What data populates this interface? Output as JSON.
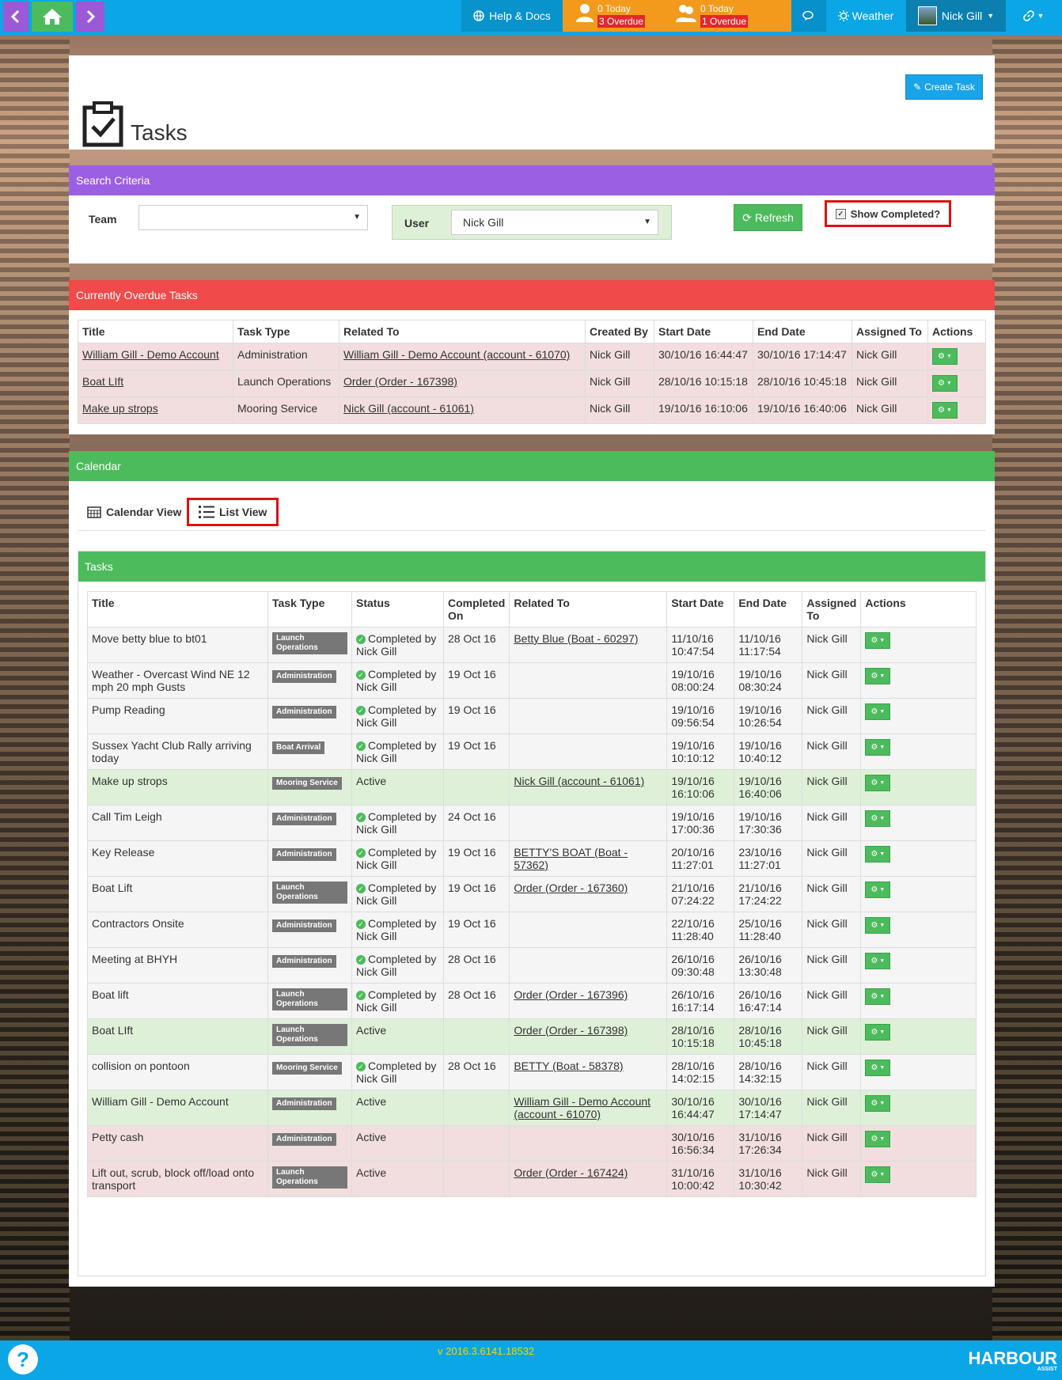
{
  "topbar": {
    "help": "Help & Docs",
    "alert1": {
      "today": "0 Today",
      "overdue": "3 Overdue"
    },
    "alert2": {
      "today": "0 Today",
      "overdue": "1 Overdue"
    },
    "weather": "Weather",
    "user": "Nick Gill"
  },
  "header": {
    "title": "Tasks",
    "create": "Create Task"
  },
  "search": {
    "heading": "Search Criteria",
    "team_label": "Team",
    "team_value": "",
    "user_label": "User",
    "user_value": "Nick Gill",
    "refresh": "Refresh",
    "show_completed": "Show Completed?"
  },
  "overdue": {
    "heading": "Currently Overdue Tasks",
    "columns": [
      "Title",
      "Task Type",
      "Related To",
      "Created By",
      "Start Date",
      "End Date",
      "Assigned To",
      "Actions"
    ],
    "rows": [
      [
        "William Gill - Demo Account",
        "Administration",
        "William Gill - Demo Account (account - 61070)",
        "Nick Gill",
        "30/10/16 16:44:47",
        "30/10/16 17:14:47",
        "Nick Gill"
      ],
      [
        "Boat LIft",
        "Launch Operations",
        "Order (Order - 167398)",
        "Nick Gill",
        "28/10/16 10:15:18",
        "28/10/16 10:45:18",
        "Nick Gill"
      ],
      [
        "Make up strops",
        "Mooring Service",
        "Nick Gill (account - 61061)",
        "Nick Gill",
        "19/10/16 16:10:06",
        "19/10/16 16:40:06",
        "Nick Gill"
      ]
    ]
  },
  "calendar": {
    "heading": "Calendar",
    "tab_calendar": "Calendar View",
    "tab_list": "List View",
    "tasks_heading": "Tasks",
    "columns": [
      "Title",
      "Task Type",
      "Status",
      "Completed On",
      "Related To",
      "Start Date",
      "End Date",
      "Assigned To",
      "Actions"
    ],
    "rows": [
      {
        "title": "Move betty blue to bt01",
        "type": "Launch Operations",
        "status": "Completed by Nick Gill",
        "completed": "28 Oct 16",
        "related": "Betty Blue (Boat - 60297)",
        "start": "11/10/16 10:47:54",
        "end": "11/10/16 11:17:54",
        "assigned": "Nick Gill",
        "tone": "grey"
      },
      {
        "title": "Weather - Overcast Wind NE 12 mph 20 mph Gusts",
        "type": "Administration",
        "status": "Completed by Nick Gill",
        "completed": "19 Oct 16",
        "related": "",
        "start": "19/10/16 08:00:24",
        "end": "19/10/16 08:30:24",
        "assigned": "Nick Gill",
        "tone": "grey"
      },
      {
        "title": "Pump Reading",
        "type": "Administration",
        "status": "Completed by Nick Gill",
        "completed": "19 Oct 16",
        "related": "",
        "start": "19/10/16 09:56:54",
        "end": "19/10/16 10:26:54",
        "assigned": "Nick Gill",
        "tone": "grey"
      },
      {
        "title": "Sussex Yacht Club Rally arriving today",
        "type": "Boat Arrival",
        "status": "Completed by Nick Gill",
        "completed": "19 Oct 16",
        "related": "",
        "start": "19/10/16 10:10:12",
        "end": "19/10/16 10:40:12",
        "assigned": "Nick Gill",
        "tone": "grey"
      },
      {
        "title": "Make up strops",
        "type": "Mooring Service",
        "status": "Active",
        "completed": "",
        "related": "Nick Gill (account - 61061)",
        "start": "19/10/16 16:10:06",
        "end": "19/10/16 16:40:06",
        "assigned": "Nick Gill",
        "tone": "green"
      },
      {
        "title": "Call Tim Leigh",
        "type": "Administration",
        "status": "Completed by Nick Gill",
        "completed": "24 Oct 16",
        "related": "",
        "start": "19/10/16 17:00:36",
        "end": "19/10/16 17:30:36",
        "assigned": "Nick Gill",
        "tone": "grey"
      },
      {
        "title": "Key Release",
        "type": "Administration",
        "status": "Completed by Nick Gill",
        "completed": "19 Oct 16",
        "related": "BETTY'S BOAT (Boat - 57362)",
        "start": "20/10/16 11:27:01",
        "end": "23/10/16 11:27:01",
        "assigned": "Nick Gill",
        "tone": "grey"
      },
      {
        "title": "Boat Lift",
        "type": "Launch Operations",
        "status": "Completed by Nick Gill",
        "completed": "19 Oct 16",
        "related": "Order (Order - 167360)",
        "start": "21/10/16 07:24:22",
        "end": "21/10/16 17:24:22",
        "assigned": "Nick Gill",
        "tone": "grey"
      },
      {
        "title": "Contractors Onsite",
        "type": "Administration",
        "status": "Completed by Nick Gill",
        "completed": "19 Oct 16",
        "related": "",
        "start": "22/10/16 11:28:40",
        "end": "25/10/16 11:28:40",
        "assigned": "Nick Gill",
        "tone": "grey"
      },
      {
        "title": "Meeting at BHYH",
        "type": "Administration",
        "status": "Completed by Nick Gill",
        "completed": "28 Oct 16",
        "related": "",
        "start": "26/10/16 09:30:48",
        "end": "26/10/16 13:30:48",
        "assigned": "Nick Gill",
        "tone": "grey"
      },
      {
        "title": "Boat lift",
        "type": "Launch Operations",
        "status": "Completed by Nick Gill",
        "completed": "28 Oct 16",
        "related": "Order (Order - 167396)",
        "start": "26/10/16 16:17:14",
        "end": "26/10/16 16:47:14",
        "assigned": "Nick Gill",
        "tone": "grey"
      },
      {
        "title": "Boat LIft",
        "type": "Launch Operations",
        "status": "Active",
        "completed": "",
        "related": "Order (Order - 167398)",
        "start": "28/10/16 10:15:18",
        "end": "28/10/16 10:45:18",
        "assigned": "Nick Gill",
        "tone": "green"
      },
      {
        "title": "collision on pontoon",
        "type": "Mooring Service",
        "status": "Completed by Nick Gill",
        "completed": "28 Oct 16",
        "related": "BETTY (Boat - 58378)",
        "start": "28/10/16 14:02:15",
        "end": "28/10/16 14:32:15",
        "assigned": "Nick Gill",
        "tone": "grey"
      },
      {
        "title": "William Gill - Demo Account",
        "type": "Administration",
        "status": "Active",
        "completed": "",
        "related": "William Gill - Demo Account (account - 61070)",
        "start": "30/10/16 16:44:47",
        "end": "30/10/16 17:14:47",
        "assigned": "Nick Gill",
        "tone": "green"
      },
      {
        "title": "Petty cash",
        "type": "Administration",
        "status": "Active",
        "completed": "",
        "related": "",
        "start": "30/10/16 16:56:34",
        "end": "31/10/16 17:26:34",
        "assigned": "Nick Gill",
        "tone": "red"
      },
      {
        "title": "Lift out, scrub, block off/load onto transport",
        "type": "Launch Operations",
        "status": "Active",
        "completed": "",
        "related": "Order (Order - 167424)",
        "start": "31/10/16 10:00:42",
        "end": "31/10/16 10:30:42",
        "assigned": "Nick Gill",
        "tone": "red"
      }
    ]
  },
  "footer": {
    "version": "v 2016.3.6141.18532",
    "brand": "HARBOUR",
    "brand_sub": "ASSIST",
    "help": "?"
  },
  "colors": {
    "topbar": "#0aa6e6",
    "purple": "#9b5fe3",
    "red": "#f04a4a",
    "green": "#4cbb5c",
    "orange": "#f39a1c"
  }
}
